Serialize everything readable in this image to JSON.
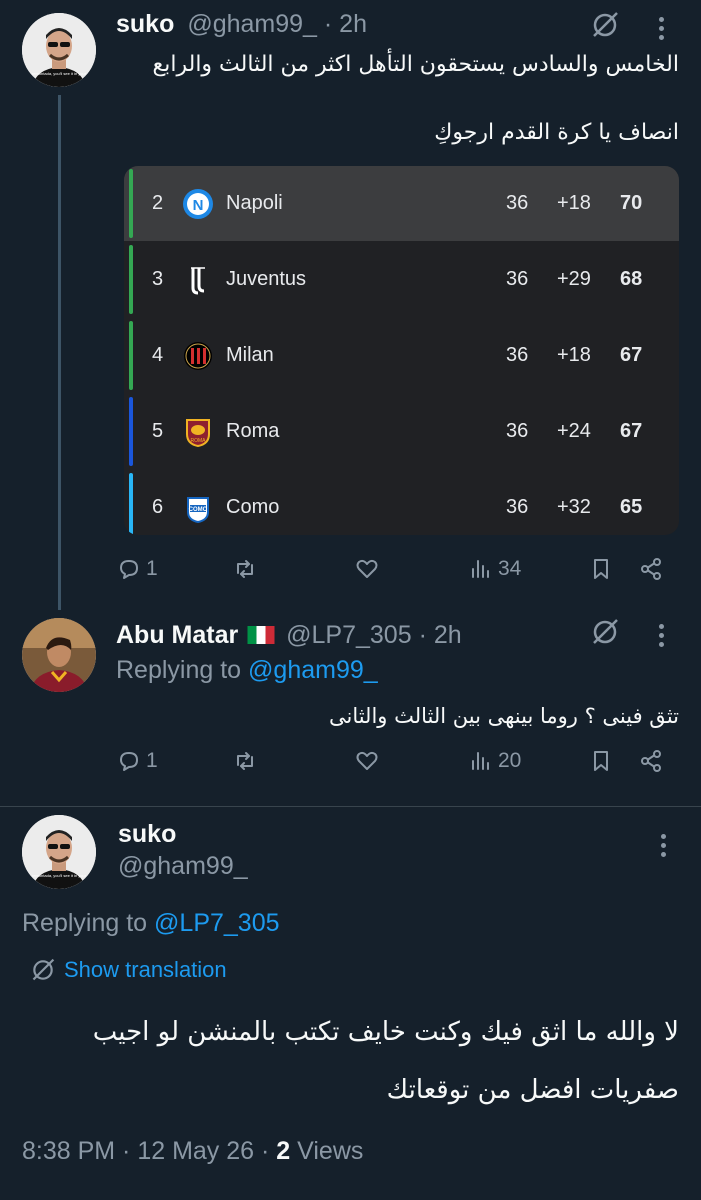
{
  "colors": {
    "background": "#15202b",
    "muted": "#8b98a5",
    "link": "#1d9bf0",
    "table_bg": "#202124"
  },
  "post1": {
    "name": "suko",
    "handle": "@gham99_",
    "time": "· 2h",
    "text_line1": "الخامس والسادس يستحقون التأهل اكثر من الثالث والرابع",
    "text_line2": "انصاف يا كرة القدم ارجوكِ",
    "table": {
      "rows": [
        {
          "pos": "2",
          "team": "Napoli",
          "played": "36",
          "gd": "+18",
          "pts": "70",
          "bar": "#34a853",
          "logo": "napoli-logo",
          "highlighted": true
        },
        {
          "pos": "3",
          "team": "Juventus",
          "played": "36",
          "gd": "+29",
          "pts": "68",
          "bar": "#34a853",
          "logo": "juventus-logo",
          "highlighted": false
        },
        {
          "pos": "4",
          "team": "Milan",
          "played": "36",
          "gd": "+18",
          "pts": "67",
          "bar": "#34a853",
          "logo": "milan-logo",
          "highlighted": false
        },
        {
          "pos": "5",
          "team": "Roma",
          "played": "36",
          "gd": "+24",
          "pts": "67",
          "bar": "#1a56db",
          "logo": "roma-logo",
          "highlighted": false
        },
        {
          "pos": "6",
          "team": "Como",
          "played": "36",
          "gd": "+32",
          "pts": "65",
          "bar": "#29b6f6",
          "logo": "como-logo",
          "highlighted": false
        }
      ]
    },
    "replies": "1",
    "views": "34"
  },
  "post2": {
    "name": "Abu Matar",
    "flag": "🇮🇹",
    "handle": "@LP7_305",
    "time": "· 2h",
    "replying_label": "Replying to",
    "replying_handle": "@gham99_",
    "text": "تثق فينى ؟ روما بينهى بين الثالث والثانى",
    "replies": "1",
    "views": "20"
  },
  "post3": {
    "name": "suko",
    "handle": "@gham99_",
    "replying_label": "Replying to",
    "replying_handle": "@LP7_305",
    "show_translation": "Show translation",
    "text_line1": "لا والله ما اثق فيك وكنت خايف تكتب بالمنشن لو اجيب",
    "text_line2": "صفريات افضل من توقعاتك",
    "timestamp": "8:38 PM · 12 May 26 · ",
    "views_count": "2",
    "views_label": " Views"
  }
}
